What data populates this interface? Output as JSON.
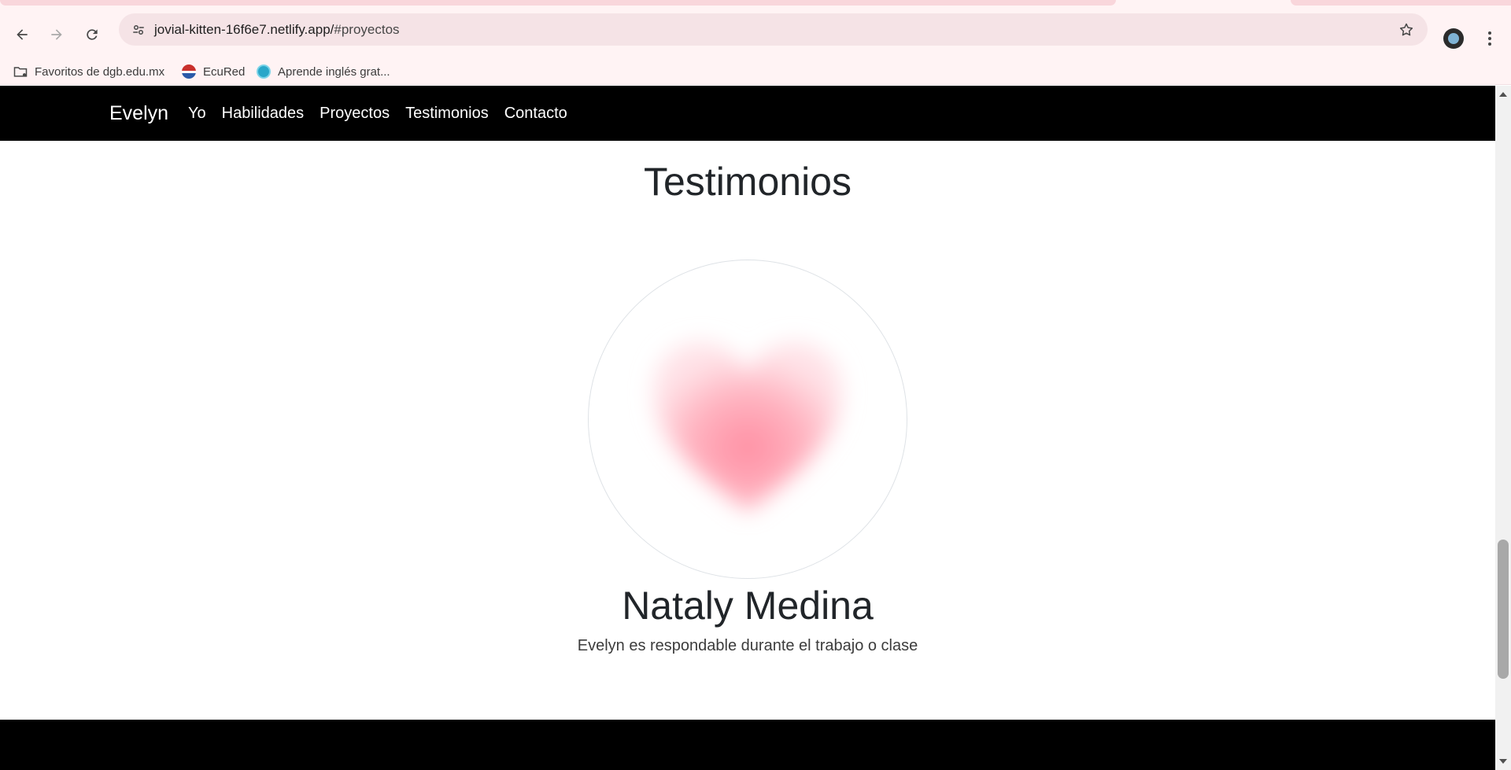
{
  "browser": {
    "url_host": "jovial-kitten-16f6e7.netlify.app/",
    "url_hash": "#proyectos",
    "bookmarks": [
      {
        "label": "Favoritos de dgb.edu.mx",
        "icon": "folder-icon"
      },
      {
        "label": "EcuRed",
        "icon": "ecured-icon"
      },
      {
        "label": "Aprende inglés grat...",
        "icon": "aprende-icon"
      }
    ]
  },
  "site": {
    "brand": "Evelyn",
    "nav": [
      {
        "label": "Yo"
      },
      {
        "label": "Habilidades"
      },
      {
        "label": "Proyectos"
      },
      {
        "label": "Testimonios"
      },
      {
        "label": "Contacto"
      }
    ],
    "colors": {
      "nav_bg": "#000000",
      "heart": "#ff8fa3"
    }
  },
  "testimonios": {
    "title": "Testimonios",
    "image_icon": "heart-icon",
    "name": "Nataly Medina",
    "text": "Evelyn es respondable durante el trabajo o clase"
  }
}
